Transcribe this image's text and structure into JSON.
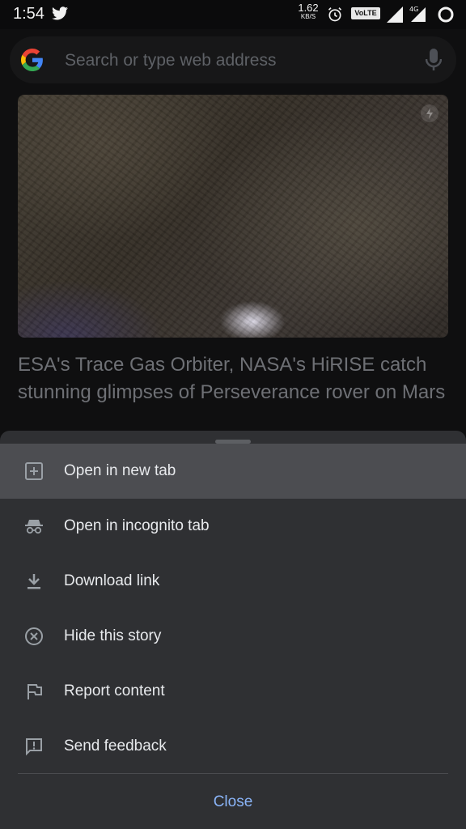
{
  "status_bar": {
    "time": "1:54",
    "speed_value": "1.62",
    "speed_unit": "KB/S",
    "volte": "VoLTE",
    "network_type": "4G"
  },
  "search": {
    "placeholder": "Search or type web address"
  },
  "article": {
    "title": "ESA's Trace Gas Orbiter, NASA's HiRISE catch stunning glimpses of Perseverance rover on Mars"
  },
  "context_menu": {
    "items": [
      {
        "label": "Open in new tab",
        "icon": "add-tab-icon"
      },
      {
        "label": "Open in incognito tab",
        "icon": "incognito-icon"
      },
      {
        "label": "Download link",
        "icon": "download-icon"
      },
      {
        "label": "Hide this story",
        "icon": "hide-icon"
      },
      {
        "label": "Report content",
        "icon": "flag-icon"
      },
      {
        "label": "Send feedback",
        "icon": "feedback-icon"
      }
    ],
    "close_label": "Close"
  },
  "colors": {
    "accent": "#8ab4f8",
    "sheet_background": "#2f3033",
    "highlight": "#4c4d51"
  }
}
